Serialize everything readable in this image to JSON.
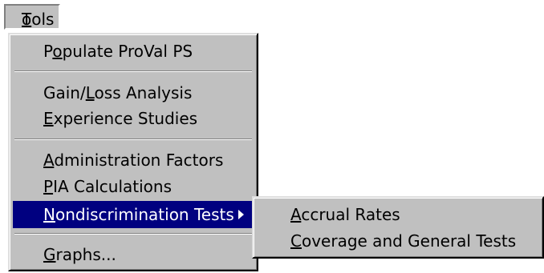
{
  "menubar": {
    "tools": {
      "mnemonic": "T",
      "rest": "ools"
    }
  },
  "menu": {
    "items": [
      {
        "pre": "P",
        "mn": "o",
        "post": "pulate ProVal PS"
      },
      {
        "pre": "Gain/",
        "mn": "L",
        "post": "oss Analysis"
      },
      {
        "pre": "",
        "mn": "E",
        "post": "xperience Studies"
      },
      {
        "pre": "",
        "mn": "A",
        "post": "dministration Factors"
      },
      {
        "pre": "",
        "mn": "P",
        "post": "IA Calculations"
      },
      {
        "pre": "",
        "mn": "N",
        "post": "ondiscrimination Tests"
      },
      {
        "pre": "",
        "mn": "G",
        "post": "raphs..."
      }
    ]
  },
  "submenu": {
    "items": [
      {
        "pre": "",
        "mn": "A",
        "post": "ccrual Rates"
      },
      {
        "pre": "",
        "mn": "C",
        "post": "overage and General Tests"
      }
    ]
  },
  "colors": {
    "menu_bg": "#c0c0c0",
    "highlight_bg": "#000080",
    "highlight_text": "#ffffff"
  }
}
